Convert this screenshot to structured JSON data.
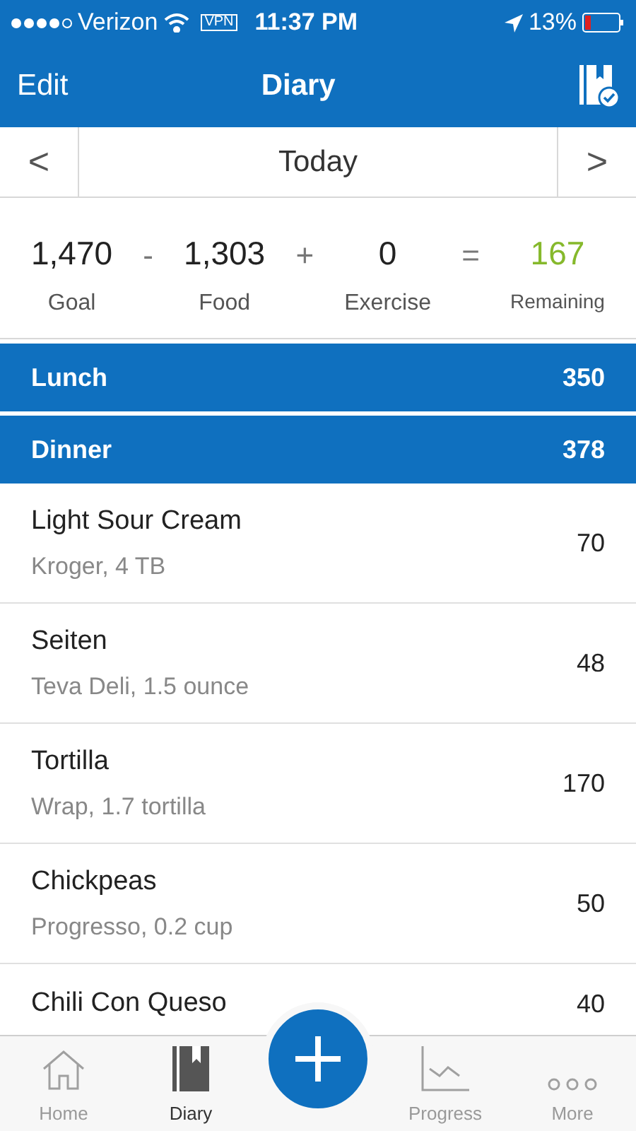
{
  "status_bar": {
    "carrier": "Verizon",
    "vpn": "VPN",
    "time": "11:37 PM",
    "battery": "13%"
  },
  "nav": {
    "left": "Edit",
    "title": "Diary"
  },
  "date": {
    "prev": "<",
    "label": "Today",
    "next": ">"
  },
  "summary": [
    {
      "kind": "value",
      "value": "1,470",
      "label": "Goal"
    },
    {
      "kind": "op",
      "value": "-"
    },
    {
      "kind": "value",
      "value": "1,303",
      "label": "Food"
    },
    {
      "kind": "op",
      "value": "+"
    },
    {
      "kind": "value",
      "value": "0",
      "label": "Exercise"
    },
    {
      "kind": "op",
      "value": "="
    },
    {
      "kind": "result",
      "value": "167",
      "label": "Remaining"
    }
  ],
  "meals": [
    {
      "name": "Lunch",
      "calories": "350"
    },
    {
      "name": "Dinner",
      "calories": "378",
      "items": [
        {
          "name": "Light Sour Cream",
          "detail": "Kroger, 4 TB",
          "calories": "70"
        },
        {
          "name": "Seiten",
          "detail": "Teva Deli, 1.5 ounce",
          "calories": "48"
        },
        {
          "name": "Tortilla",
          "detail": "Wrap, 1.7 tortilla",
          "calories": "170"
        },
        {
          "name": "Chickpeas",
          "detail": "Progresso, 0.2 cup",
          "calories": "50"
        },
        {
          "name": "Chili Con Queso",
          "calories": "40"
        }
      ]
    }
  ],
  "tabs": [
    {
      "label": "Home",
      "selected": false
    },
    {
      "label": "Diary",
      "selected": true
    },
    {
      "kind": "add"
    },
    {
      "label": "Progress",
      "selected": false
    },
    {
      "label": "More",
      "selected": false
    }
  ]
}
